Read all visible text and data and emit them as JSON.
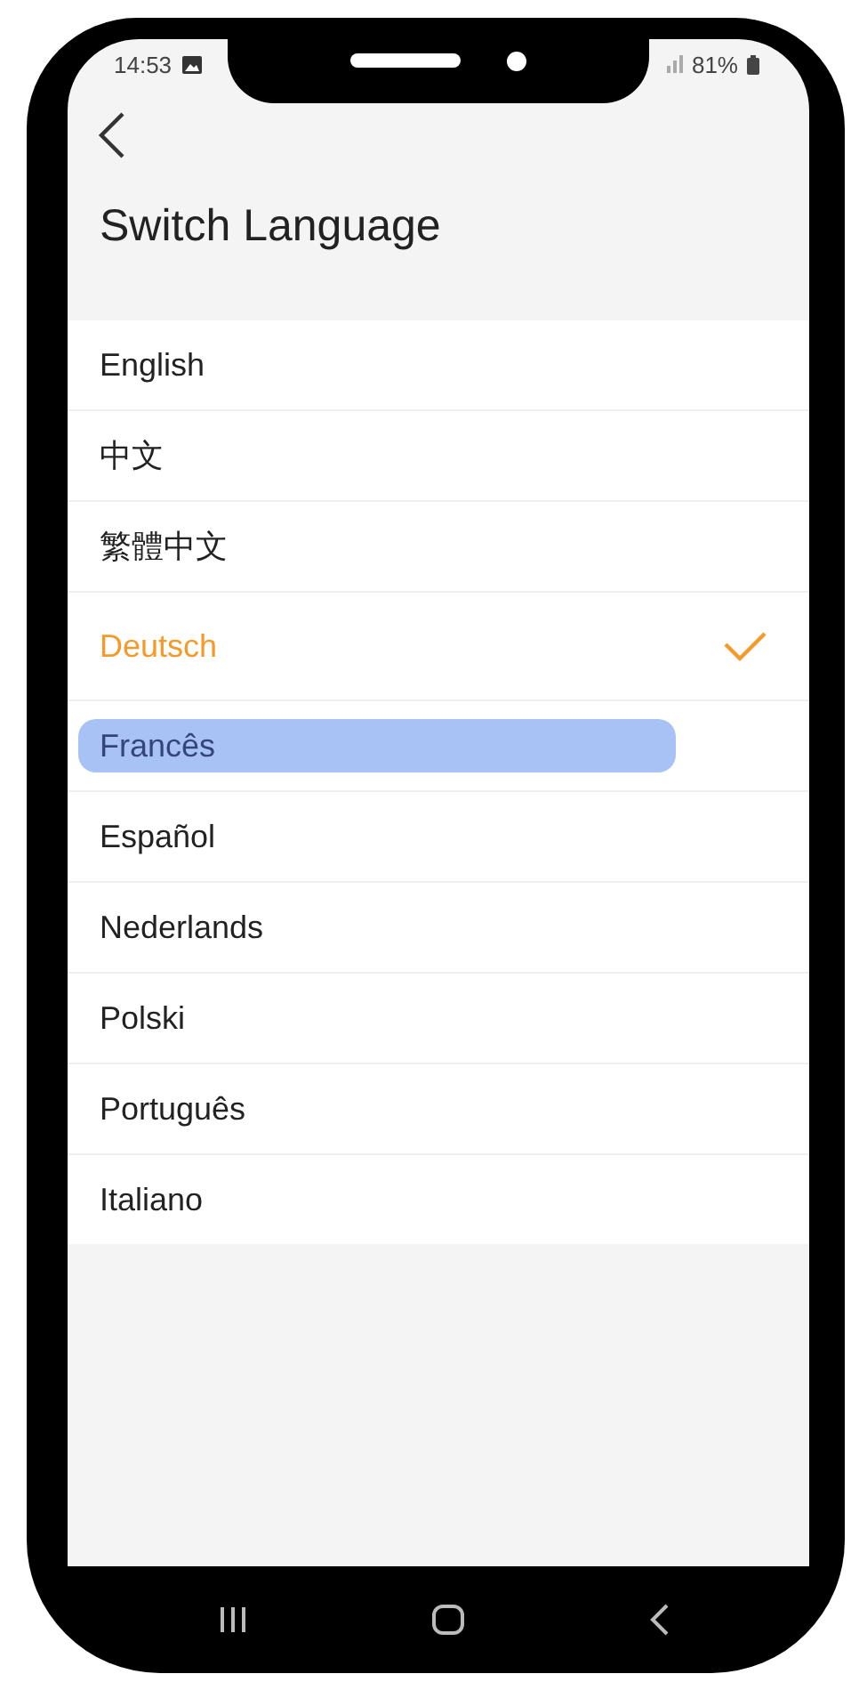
{
  "status_bar": {
    "time": "14:53",
    "battery": "81%"
  },
  "title": "Switch Language",
  "languages": [
    {
      "label": "English",
      "selected": false,
      "highlighted": false
    },
    {
      "label": "中文",
      "selected": false,
      "highlighted": false
    },
    {
      "label": "繁體中文",
      "selected": false,
      "highlighted": false
    },
    {
      "label": "Deutsch",
      "selected": true,
      "highlighted": false
    },
    {
      "label": "Francês",
      "selected": false,
      "highlighted": true
    },
    {
      "label": "Español",
      "selected": false,
      "highlighted": false
    },
    {
      "label": "Nederlands",
      "selected": false,
      "highlighted": false
    },
    {
      "label": "Polski",
      "selected": false,
      "highlighted": false
    },
    {
      "label": "Português",
      "selected": false,
      "highlighted": false
    },
    {
      "label": "Italiano",
      "selected": false,
      "highlighted": false
    }
  ]
}
